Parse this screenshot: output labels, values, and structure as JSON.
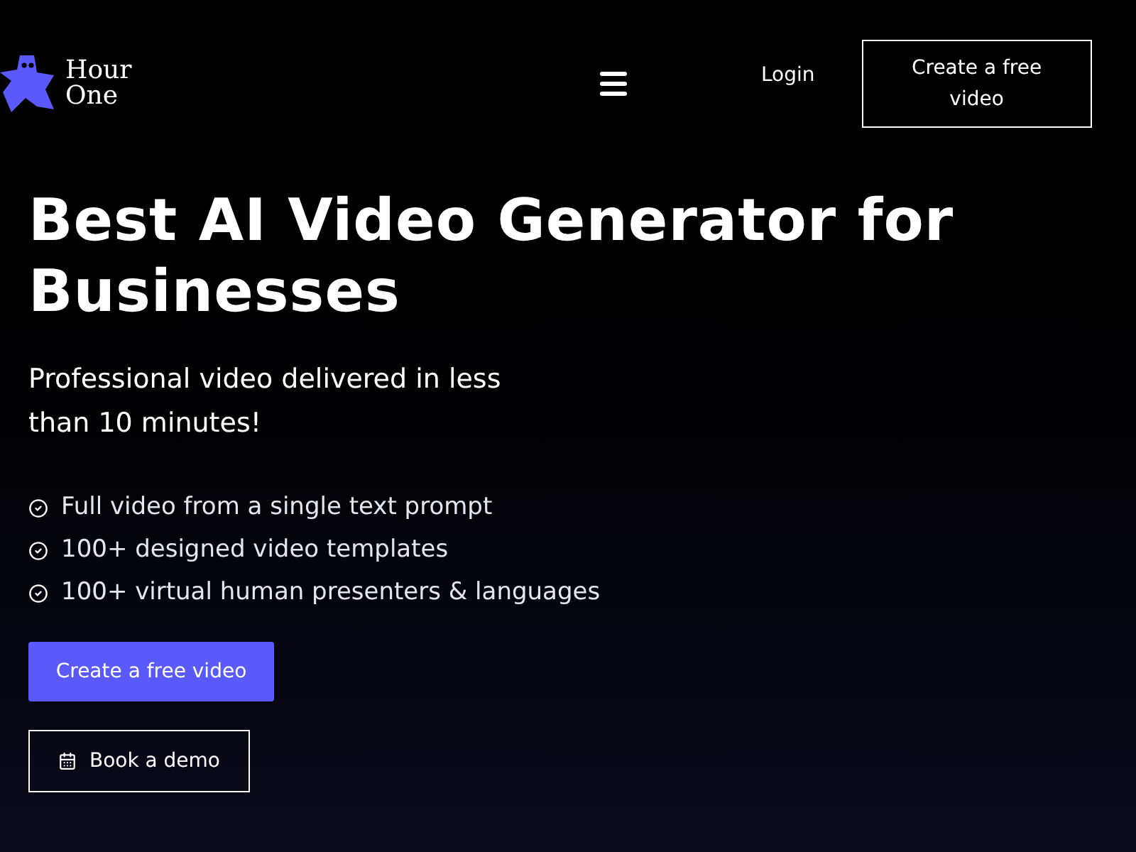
{
  "header": {
    "logo": [
      "Hour",
      "One"
    ],
    "login": "Login",
    "cta": "Create a free video"
  },
  "hero": {
    "title": "Best AI Video Generator for Businesses",
    "subtitle": "Professional video delivered in less than 10 minutes!",
    "features": [
      "Full video from a single text prompt",
      "100+ designed video templates",
      "100+ virtual human presenters & languages"
    ],
    "primary_button": "Create a free video",
    "secondary_button": "Book a demo"
  }
}
